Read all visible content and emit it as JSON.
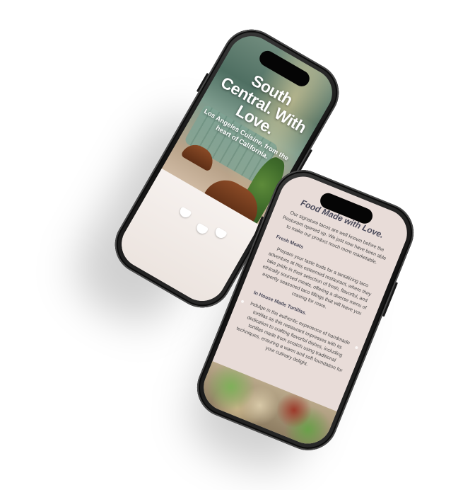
{
  "hero_phone": {
    "title": "South Central. With Love.",
    "subtitle": "Los Angeles Cuisine, from the heart of California."
  },
  "content_phone": {
    "title": "Food Made with Love.",
    "intro": "Our signature tacos are well known before the Resturant opened up. We just now have been able to make our product much more marketable.",
    "section1_heading": "Fresh Meats",
    "section1_text": "Prepare your taste buds for a tantalizing taco adventure at this esteemed restaurant, where they take pride in their selection of fresh, flavorful, and ethically sourced meats, offering a diverse menu of expertly seasoned taco fillings that will leave you craving for more.",
    "section2_heading": "In House Made Tortillas.",
    "section2_text": "Indulge in the authentic experience of handmade tortillas as this restaurant impresses with its dedication to crafting flavorful dishes, including tortillas made from scratch using traditional techniques, ensuring a warm and soft foundation for your culinary delight."
  },
  "colors": {
    "phone_frame": "#1a1a1a",
    "content_background": "#e8dcd8",
    "heading_text": "#4a4a5a",
    "body_text": "#4a4a4a",
    "hero_text": "#ffffff"
  }
}
